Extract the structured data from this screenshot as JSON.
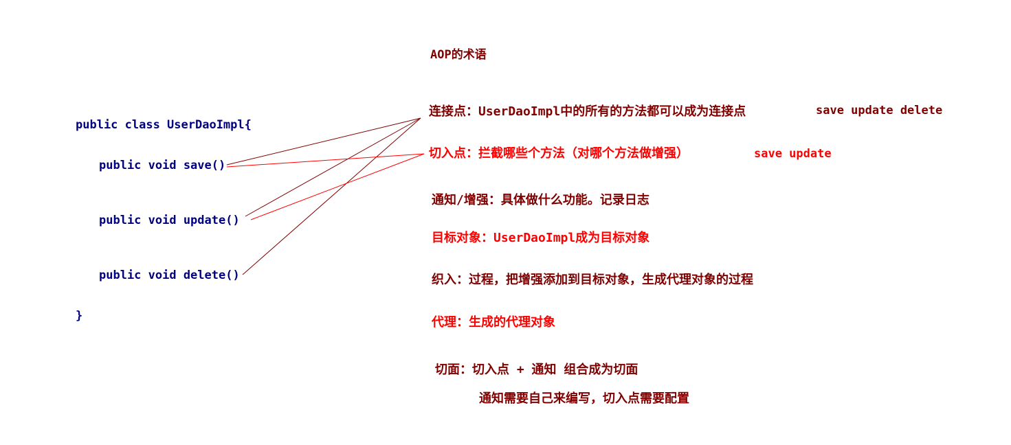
{
  "title": "AOP的术语",
  "code": {
    "class_decl": "public class UserDaoImpl{",
    "methods": [
      "public void save()",
      "public void update()",
      "public void delete()"
    ],
    "close": "}"
  },
  "terms": {
    "join_point": {
      "text": "连接点：UserDaoImpl中的所有的方法都可以成为连接点",
      "example": "save update delete"
    },
    "pointcut": {
      "text": "切入点：拦截哪些个方法（对哪个方法做增强）",
      "example": "save update"
    },
    "advice": "通知/增强：具体做什么功能。记录日志",
    "target": "目标对象：UserDaoImpl成为目标对象",
    "weaving": "织入：过程，把增强添加到目标对象，生成代理对象的过程",
    "proxy": "代理：生成的代理对象",
    "aspect": "切面：切入点 + 通知 组合成为切面",
    "aspect_note": "通知需要自己来编写，切入点需要配置"
  },
  "colors": {
    "code": "#000080",
    "dark_red": "#800000",
    "red": "#ff0000",
    "join_point_lines": "#800000",
    "pointcut_lines": "#ff0000"
  }
}
